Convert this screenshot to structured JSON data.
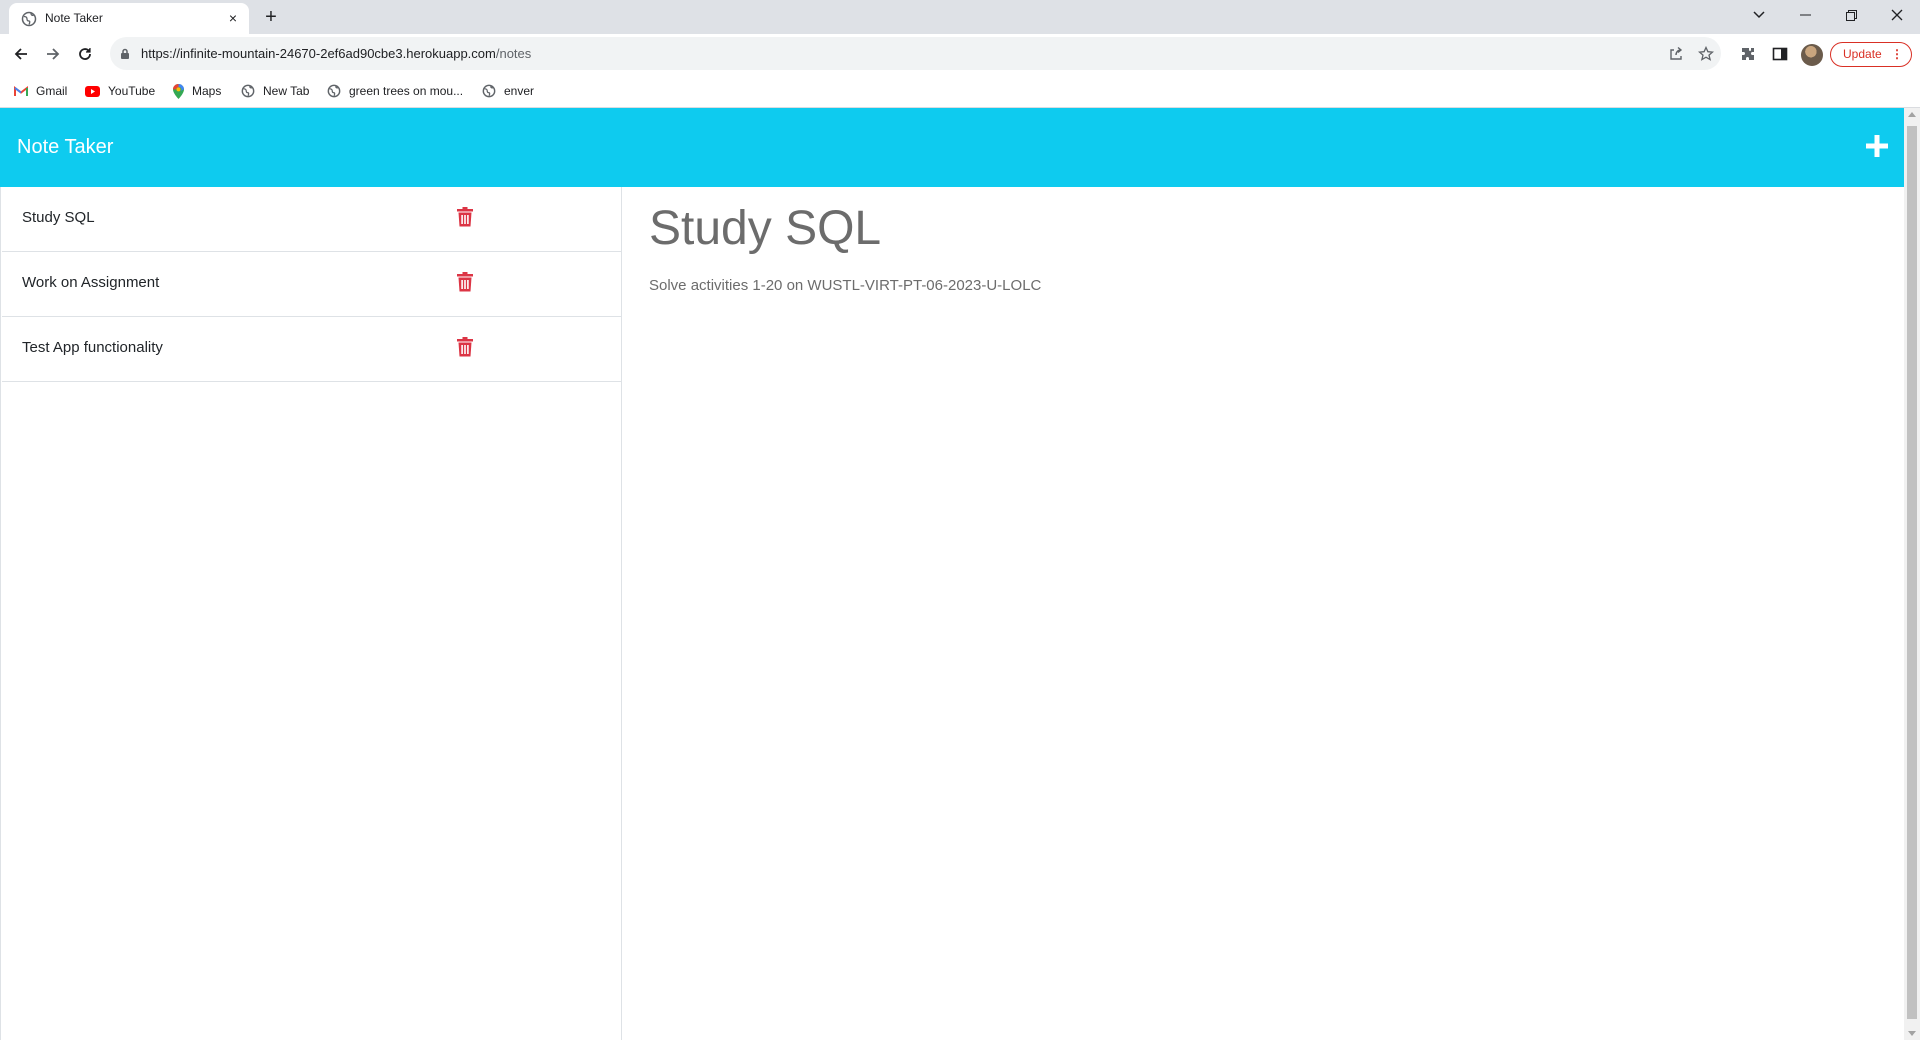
{
  "browser": {
    "tab_title": "Note Taker",
    "tab_close": "×",
    "new_tab": "+",
    "url_host": "https://infinite-mountain-24670-2ef6ad90cbe3.herokuapp.com",
    "url_path": "/notes",
    "update_label": "Update",
    "update_menu": "⋮",
    "bookmarks": [
      {
        "label": "Gmail",
        "icon": "gmail-icon"
      },
      {
        "label": "YouTube",
        "icon": "youtube-icon"
      },
      {
        "label": "Maps",
        "icon": "maps-icon"
      },
      {
        "label": "New Tab",
        "icon": "globe-icon"
      },
      {
        "label": "green trees on mou...",
        "icon": "globe-icon"
      },
      {
        "label": "enver",
        "icon": "globe-icon"
      }
    ]
  },
  "app": {
    "brand": "Note Taker",
    "accent_color": "#0ecbef",
    "delete_color": "#dc3545",
    "notes": [
      {
        "title": "Study SQL"
      },
      {
        "title": "Work on Assignment"
      },
      {
        "title": "Test App functionality"
      }
    ],
    "active_note": {
      "title": "Study SQL",
      "text": "Solve activities 1-20 on WUSTL-VIRT-PT-06-2023-U-LOLC"
    }
  }
}
